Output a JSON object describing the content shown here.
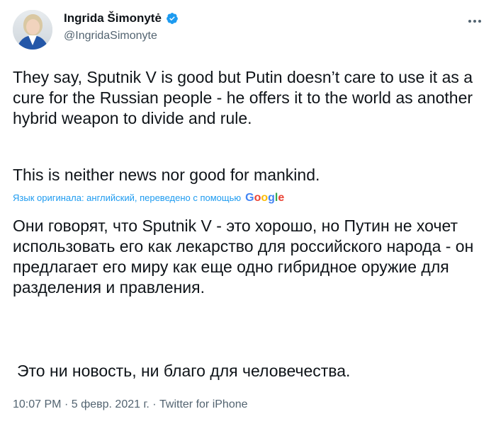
{
  "author": {
    "name": "Ingrida Šimonytė",
    "handle": "@IngridaSimonyte",
    "verified": true
  },
  "tweet": {
    "text_original_p1": "They say, Sputnik V is good but Putin doesn’t care to use it as a cure for the Russian people - he offers it to the world as another hybrid weapon to divide and rule.",
    "text_original_p2": "This is neither news nor good for mankind.",
    "translation_note": "Язык оригинала: английский, переведено с помощью",
    "translation_provider": "Google",
    "text_translated_p1": "Они говорят, что Sputnik V - это хорошо, но Путин не хочет использовать его как лекарство для российского народа - он предлагает его миру как еще одно гибридное оружие для разделения и правления.",
    "text_translated_p2": "Это ни новость, ни благо для человечества."
  },
  "meta": {
    "time": "10:07 PM",
    "separator": "·",
    "date": "5 февр. 2021 г.",
    "source": "Twitter for iPhone"
  },
  "colors": {
    "text": "#0f1419",
    "secondary": "#536471",
    "link": "#1d9bf0",
    "verified": "#1d9bf0"
  },
  "icons": [
    "verified-badge-icon",
    "more-options-icon",
    "google-logo"
  ]
}
